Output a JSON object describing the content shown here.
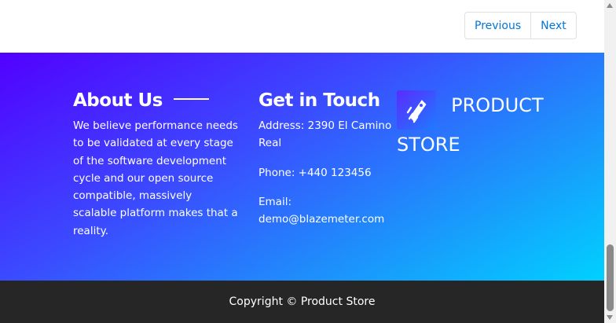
{
  "pagination": {
    "previous_label": "Previous",
    "next_label": "Next"
  },
  "about": {
    "heading": "About Us",
    "text": "We believe performance needs to be validated at every stage of the software development cycle and our open source compatible, massively scalable platform makes that a reality."
  },
  "contact": {
    "heading": "Get in Touch",
    "address": "Address: 2390 El Camino Real",
    "phone": "Phone: +440 123456",
    "email": "Email: demo@blazemeter.com"
  },
  "brand": {
    "line1": "PRODUCT",
    "line2": "STORE",
    "logo_icon": "rocket-icon"
  },
  "footer": {
    "copyright": "Copyright © Product Store"
  },
  "colors": {
    "gradient_start": "#5200ff",
    "gradient_end": "#00d1ff",
    "bottom_bar": "#262626",
    "link": "#0275d8"
  }
}
